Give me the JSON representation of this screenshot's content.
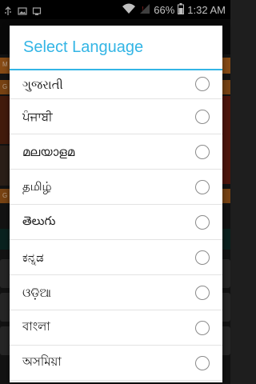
{
  "status_bar": {
    "battery_percent": "66%",
    "time": "1:32 AM",
    "icons": [
      "usb-icon",
      "photo-icon",
      "screenshot-icon",
      "wifi-icon",
      "signal-icon",
      "battery-icon"
    ]
  },
  "background_app": {
    "labels": [
      "M",
      "G",
      "G"
    ]
  },
  "dialog": {
    "title": "Select Language",
    "accent_color": "#33b5e5",
    "items": [
      {
        "label": "ગુજરાતી",
        "selected": false
      },
      {
        "label": "ਪੰਜਾਬੀ",
        "selected": false
      },
      {
        "label": "മലയാളമ",
        "selected": false
      },
      {
        "label": "தமிழ்",
        "selected": false
      },
      {
        "label": "తెలుగు",
        "selected": false
      },
      {
        "label": "ಕನ್ನಡ",
        "selected": false
      },
      {
        "label": "ଓଡ଼ିଆ",
        "selected": false
      },
      {
        "label": "বাংলা",
        "selected": false
      },
      {
        "label": "অসমিয়া",
        "selected": false
      }
    ]
  }
}
